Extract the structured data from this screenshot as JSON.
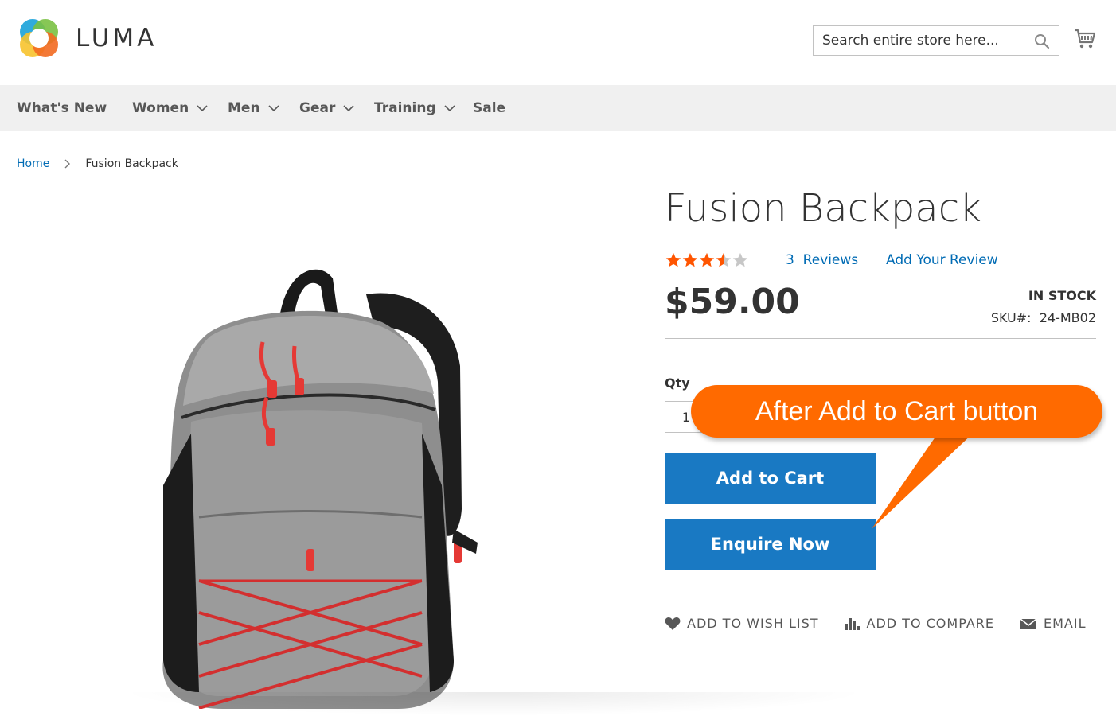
{
  "header": {
    "logo_text": "LUMA",
    "search_placeholder": "Search entire store here...",
    "icons": {
      "search": "search-icon",
      "cart": "cart-icon"
    }
  },
  "nav": {
    "items": [
      {
        "label": "What's New",
        "has_dropdown": false
      },
      {
        "label": "Women",
        "has_dropdown": true
      },
      {
        "label": "Men",
        "has_dropdown": true
      },
      {
        "label": "Gear",
        "has_dropdown": true
      },
      {
        "label": "Training",
        "has_dropdown": true
      },
      {
        "label": "Sale",
        "has_dropdown": false
      }
    ]
  },
  "breadcrumb": {
    "home": "Home",
    "current": "Fusion Backpack"
  },
  "product": {
    "title": "Fusion Backpack",
    "rating": {
      "value": 3.5,
      "max": 5
    },
    "reviews_count": "3",
    "reviews_word": "Reviews",
    "add_review": "Add Your Review",
    "price": "$59.00",
    "stock": "IN STOCK",
    "sku_label": "SKU#:",
    "sku": "24-MB02",
    "qty_label": "Qty",
    "qty_value": "1"
  },
  "buttons": {
    "add_to_cart": "Add to Cart",
    "enquire": "Enquire Now"
  },
  "actions": {
    "wishlist": "ADD TO WISH LIST",
    "compare": "ADD TO COMPARE",
    "email": "EMAIL"
  },
  "callout": {
    "text": "After Add to Cart button"
  },
  "colors": {
    "accent_blue": "#1979c3",
    "link_blue": "#006bb4",
    "star_orange": "#ff5501",
    "callout_orange": "#ff6a00",
    "nav_background": "#f0f0f0"
  }
}
